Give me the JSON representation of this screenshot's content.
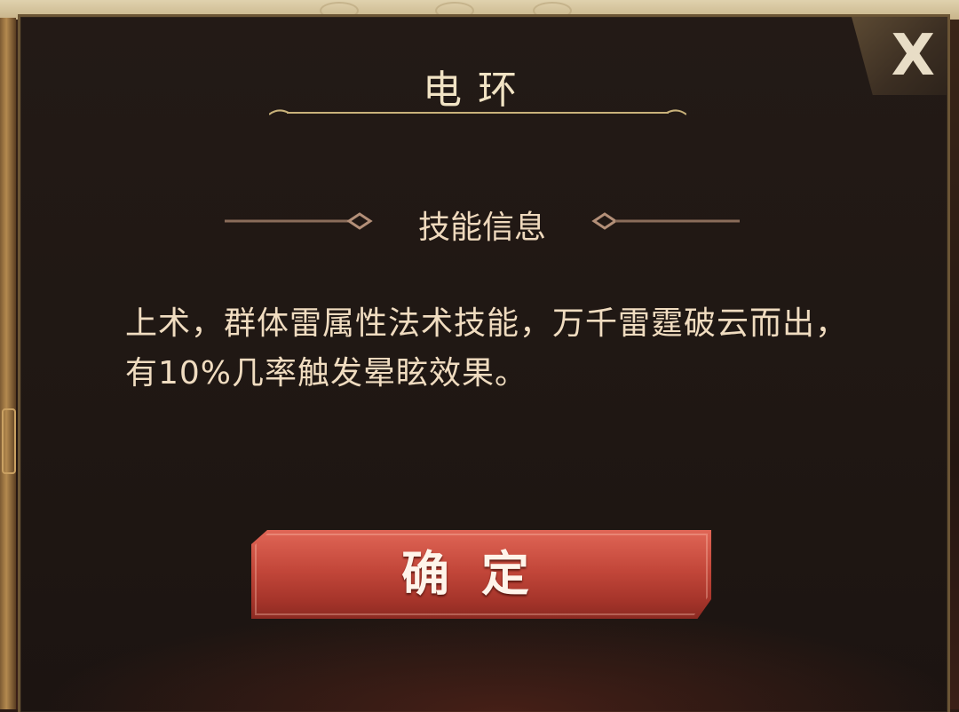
{
  "dialog": {
    "title": "电环",
    "close_symbol": "X",
    "section_label": "技能信息",
    "description": "上术，群体雷属性法术技能，万千雷霆破云而出，有10%几率触发晕眩效果。",
    "confirm_label": "确定"
  },
  "colors": {
    "panel_bg": "#211815",
    "border": "#6b5535",
    "text_light": "#f0dcc0",
    "button_red": "#c3473a"
  }
}
